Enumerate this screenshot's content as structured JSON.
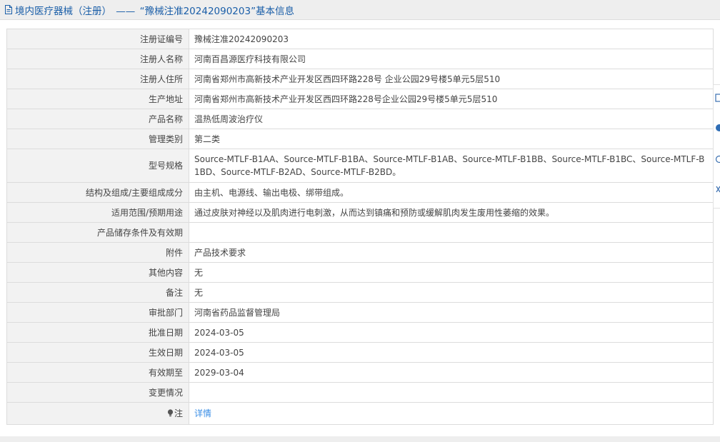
{
  "header": {
    "category": "境内医疗器械（注册）",
    "separator": "——",
    "quote": "“豫械注准20242090203”基本信息"
  },
  "rows": [
    {
      "label": "注册证编号",
      "value": "豫械注准20242090203"
    },
    {
      "label": "注册人名称",
      "value": "河南百昌源医疗科技有限公司"
    },
    {
      "label": "注册人住所",
      "value": "河南省郑州市高新技术产业开发区西四环路228号 企业公园29号楼5单元5层510"
    },
    {
      "label": "生产地址",
      "value": "河南省郑州市高新技术产业开发区西四环路228号企业公园29号楼5单元5层510"
    },
    {
      "label": "产品名称",
      "value": "温热低周波治疗仪"
    },
    {
      "label": "管理类别",
      "value": "第二类"
    },
    {
      "label": "型号规格",
      "value": "Source-MTLF-B1AA、Source-MTLF-B1BA、Source-MTLF-B1AB、Source-MTLF-B1BB、Source-MTLF-B1BC、Source-MTLF-B1BD、Source-MTLF-B2AD、Source-MTLF-B2BD。"
    },
    {
      "label": "结构及组成/主要组成成分",
      "value": "由主机、电源线、输出电极、绑带组成。"
    },
    {
      "label": "适用范围/预期用途",
      "value": "通过皮肤对神经以及肌肉进行电刺激，从而达到镇痛和预防或缓解肌肉发生废用性萎缩的效果。"
    },
    {
      "label": "产品储存条件及有效期",
      "value": ""
    },
    {
      "label": "附件",
      "value": "产品技术要求"
    },
    {
      "label": "其他内容",
      "value": "无"
    },
    {
      "label": "备注",
      "value": "无"
    },
    {
      "label": "审批部门",
      "value": "河南省药品监督管理局"
    },
    {
      "label": "批准日期",
      "value": "2024-03-05"
    },
    {
      "label": "生效日期",
      "value": "2024-03-05"
    },
    {
      "label": "有效期至",
      "value": "2029-03-04"
    },
    {
      "label": "变更情况",
      "value": ""
    }
  ],
  "note": {
    "label": "注",
    "link": "详情"
  },
  "icons": {
    "header": "document-icon",
    "note": "lightbulb-icon"
  },
  "colors": {
    "header_text": "#1a5ea8",
    "link": "#3a8ee6",
    "label_bg": "#f2f2f2",
    "border": "#dcdcdc"
  }
}
